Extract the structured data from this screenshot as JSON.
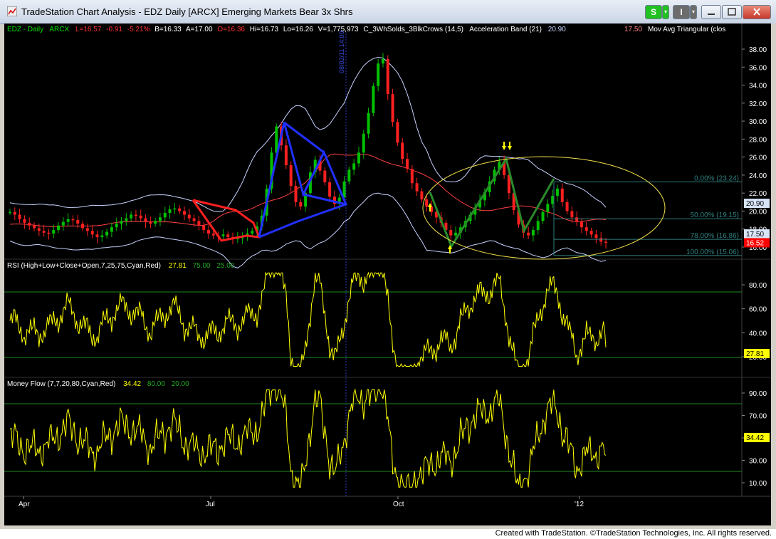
{
  "window": {
    "title": "TradeStation Chart Analysis - EDZ Daily [ARCX] Emerging Markets Bear 3x Shrs",
    "symbol_button": "S",
    "tools_button": "I"
  },
  "price_panel": {
    "symbol": "EDZ - Daily",
    "exchange": "ARCX",
    "last": "L=16.57",
    "change": "-0.91",
    "change_pct": "-5.21%",
    "bid": "B=16.33",
    "ask": "A=17.00",
    "open": "O=16.36",
    "high": "Hi=16.73",
    "low": "Lo=16.26",
    "volume": "V=1,775,973",
    "study1": "C_3WhSolds_3BlkCrows (14,5)",
    "study2": "Acceleration Band (21)",
    "study2_value": "20.90",
    "study3_value": "17.50",
    "study3": "Mov Avg Triangular (clos",
    "vertical_marker": "08/02/11 14:00",
    "y_ticks": [
      "38.00",
      "36.00",
      "34.00",
      "32.00",
      "30.00",
      "28.00",
      "26.00",
      "24.00",
      "22.00",
      "20.00",
      "18.00",
      "16.00"
    ],
    "fib_levels": [
      {
        "label": "0.00% (23.24)",
        "price": 23.24
      },
      {
        "label": "50.00% (19.15)",
        "price": 19.15
      },
      {
        "label": "78.00% (16.86)",
        "price": 16.86
      },
      {
        "label": "100.00% (15.06)",
        "price": 15.06
      }
    ],
    "badges": [
      {
        "text": "20.90",
        "price": 20.9,
        "bg": "#d8e4f8",
        "fg": "#000000"
      },
      {
        "text": "17.50",
        "price": 17.5,
        "bg": "#d8e4f8",
        "fg": "#000000"
      },
      {
        "text": "16.52",
        "price": 16.52,
        "bg": "#ff0000",
        "fg": "#ffffff"
      }
    ]
  },
  "rsi_panel": {
    "title": "RSI (High+Low+Close+Open,7,25,75,Cyan,Red)",
    "value": "27.81",
    "overbought": "75.00",
    "oversold": "25.00",
    "y_ticks": [
      "80.00",
      "60.00",
      "40.00",
      "20.00"
    ],
    "badge": "27.81"
  },
  "mf_panel": {
    "title": "Money Flow (7,7,20,80,Cyan,Red)",
    "value": "34.42",
    "overbought": "80.00",
    "oversold": "20.00",
    "y_ticks": [
      "90.00",
      "70.00",
      "50.00",
      "30.00",
      "10.00"
    ],
    "badge": "34.42"
  },
  "x_axis": {
    "labels": [
      "Apr",
      "Jul",
      "Oct",
      "'12"
    ]
  },
  "footer": "Created with TradeStation. ©TradeStation Technologies, Inc. All rights reserved.",
  "colors": {
    "up_candle": "#00c000",
    "down_candle": "#ff2020",
    "band": "#c8d2ff",
    "ma": "#ff4040",
    "fib": "#2f7f7f",
    "rsi": "#ffff00",
    "blue_pattern": "#2030ff",
    "red_pattern": "#ff2020",
    "green_pattern": "#2a8a2a",
    "ellipse": "#f2e04a"
  },
  "chart_data": {
    "type": "candlestick",
    "ylim": [
      14.5,
      39.5
    ],
    "series": [
      {
        "name": "EDZ - Daily",
        "close": [
          19.9,
          19.6,
          19.1,
          18.7,
          18.4,
          18.1,
          17.8,
          17.6,
          17.5,
          17.9,
          18.4,
          18.8,
          19.1,
          19.0,
          18.6,
          18.1,
          17.8,
          17.4,
          17.1,
          17.3,
          17.7,
          18.2,
          18.6,
          18.9,
          19.2,
          19.6,
          19.5,
          19.2,
          18.8,
          18.6,
          18.9,
          19.3,
          19.8,
          20.2,
          20.3,
          20.0,
          19.6,
          19.2,
          18.9,
          18.4,
          17.9,
          17.5,
          17.3,
          17.2,
          17.4,
          17.1,
          16.9,
          17.0,
          17.2,
          17.5,
          17.8,
          18.3,
          19.5,
          22.5,
          26.5,
          29.4,
          27.3,
          25.1,
          22.8,
          21.0,
          20.5,
          22.0,
          24.3,
          25.7,
          24.5,
          23.2,
          21.6,
          20.8,
          21.5,
          23.3,
          24.6,
          25.3,
          26.5,
          28.6,
          30.9,
          33.9,
          36.4,
          36.9,
          33.0,
          29.9,
          27.6,
          25.8,
          24.7,
          23.1,
          22.2,
          21.3,
          20.5,
          19.9,
          19.3,
          18.7,
          17.9,
          17.3,
          17.6,
          18.2,
          18.9,
          19.6,
          20.4,
          21.2,
          22.1,
          23.3,
          24.6,
          25.5,
          24.0,
          22.0,
          20.1,
          18.5,
          17.6,
          17.3,
          17.9,
          18.9,
          19.9,
          20.8,
          21.7,
          22.5,
          21.0,
          20.0,
          19.3,
          18.8,
          18.2,
          17.8,
          17.4,
          17.0,
          16.6,
          16.5
        ]
      }
    ]
  }
}
